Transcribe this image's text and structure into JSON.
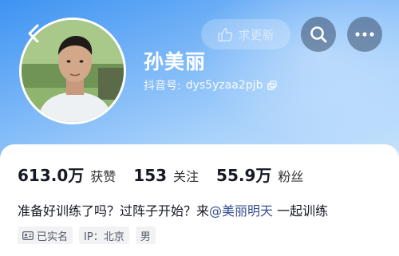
{
  "profile": {
    "name": "孙美丽",
    "douyin_id_label": "抖音号:",
    "douyin_id": "dys5yzaa2pjb",
    "bio_prefix": "准备好训练了吗？过阵子开始？来",
    "bio_mention": "@美丽明天",
    "bio_suffix": " 一起训练"
  },
  "header": {
    "wish_button_label": "求更新"
  },
  "stats": [
    {
      "value": "613.0万",
      "label": "获赞"
    },
    {
      "value": "153",
      "label": "关注"
    },
    {
      "value": "55.9万",
      "label": "粉丝"
    }
  ],
  "tags": [
    {
      "icon": "id-card-icon",
      "label": "已实名"
    },
    {
      "label": "IP：北京"
    },
    {
      "label": "男"
    }
  ],
  "icons": {
    "back": "chevron-left-icon",
    "search": "search-icon",
    "more": "more-icon",
    "wish": "hand-icon",
    "copy": "copy-icon"
  },
  "colors": {
    "header_gradient_start": "#3d93f2",
    "header_gradient_end": "#c6e2fc",
    "mention": "#36508e",
    "text_primary": "#161823"
  }
}
